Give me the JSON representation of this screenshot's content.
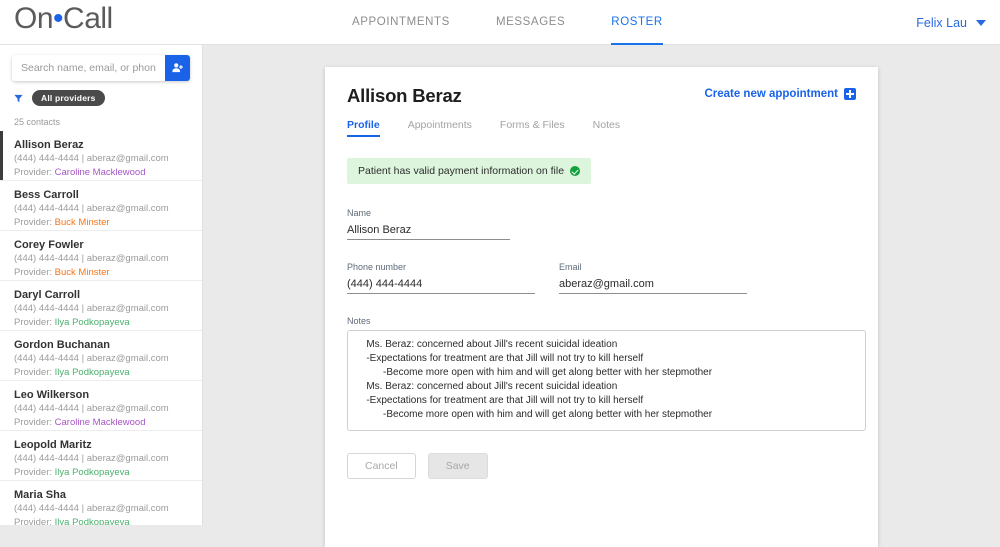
{
  "app": {
    "logo_left": "On",
    "logo_dot": "•",
    "logo_right": "Call"
  },
  "topnav": {
    "tabs": [
      {
        "label": "APPOINTMENTS",
        "active": false
      },
      {
        "label": "MESSAGES",
        "active": false
      },
      {
        "label": "ROSTER",
        "active": true
      }
    ],
    "user": "Felix Lau",
    "caret_icon": "chevron-down-icon",
    "accent": "#1a73e8"
  },
  "sidebar": {
    "search": {
      "placeholder": "Search name, email, or phone #",
      "value": "",
      "add_icon": "add-person-icon",
      "add_button_color": "#1a63e8"
    },
    "filter": {
      "icon": "filter-icon",
      "chip_label": "All providers",
      "chip_color": "#4a4a4a"
    },
    "count_label": "25 contacts",
    "contacts": [
      {
        "name": "Allison Beraz",
        "phone": "(444) 444-4444",
        "email": "aberaz@gmail.com",
        "provider_label": "Provider:",
        "provider": "Caroline Macklewood",
        "provider_color": "#a855c7",
        "selected": true
      },
      {
        "name": "Bess Carroll",
        "phone": "(444) 444-4444",
        "email": "aberaz@gmail.com",
        "provider_label": "Provider:",
        "provider": "Buck Minster",
        "provider_color": "#f97316",
        "selected": false
      },
      {
        "name": "Corey Fowler",
        "phone": "(444) 444-4444",
        "email": "aberaz@gmail.com",
        "provider_label": "Provider:",
        "provider": "Buck Minster",
        "provider_color": "#f97316",
        "selected": false
      },
      {
        "name": "Daryl Carroll",
        "phone": "(444) 444-4444",
        "email": "aberaz@gmail.com",
        "provider_label": "Provider:",
        "provider": "Ilya Podkopayeva",
        "provider_color": "#4caf6e",
        "selected": false
      },
      {
        "name": "Gordon Buchanan",
        "phone": "(444) 444-4444",
        "email": "aberaz@gmail.com",
        "provider_label": "Provider:",
        "provider": "Ilya Podkopayeva",
        "provider_color": "#4caf6e",
        "selected": false
      },
      {
        "name": "Leo Wilkerson",
        "phone": "(444) 444-4444",
        "email": "aberaz@gmail.com",
        "provider_label": "Provider:",
        "provider": "Caroline Macklewood",
        "provider_color": "#a855c7",
        "selected": false
      },
      {
        "name": "Leopold Maritz",
        "phone": "(444) 444-4444",
        "email": "aberaz@gmail.com",
        "provider_label": "Provider:",
        "provider": "Ilya Podkopayeva",
        "provider_color": "#4caf6e",
        "selected": false
      },
      {
        "name": "Maria Sha",
        "phone": "(444) 444-4444",
        "email": "aberaz@gmail.com",
        "provider_label": "Provider:",
        "provider": "Ilya Podkopayeva",
        "provider_color": "#4caf6e",
        "selected": false
      }
    ],
    "separator": "|"
  },
  "card": {
    "title": "Allison Beraz",
    "create_appointment": "Create new appointment",
    "create_icon": "plus-square-icon",
    "tabs": [
      {
        "label": "Profile",
        "active": true
      },
      {
        "label": "Appointments",
        "active": false
      },
      {
        "label": "Forms & Files",
        "active": false
      },
      {
        "label": "Notes",
        "active": false
      }
    ],
    "banner": {
      "text": "Patient has valid payment information on file",
      "icon": "check-circle-icon",
      "bg": "#ddf5dd",
      "icon_color": "#14a03c"
    },
    "fields": {
      "name_label": "Name",
      "name_value": "Allison Beraz",
      "phone_label": "Phone number",
      "phone_value": "(444) 444-4444",
      "email_label": "Email",
      "email_value": "aberaz@gmail.com",
      "notes_label": "Notes",
      "notes_value": "   Ms. Beraz: concerned about Jill's recent suicidal ideation\n   -Expectations for treatment are that Jill will not try to kill herself\n         -Become more open with him and will get along better with her stepmother\n   Ms. Beraz: concerned about Jill's recent suicidal ideation\n   -Expectations for treatment are that Jill will not try to kill herself\n         -Become more open with him and will get along better with her stepmother"
    },
    "buttons": {
      "cancel": "Cancel",
      "save": "Save"
    }
  }
}
